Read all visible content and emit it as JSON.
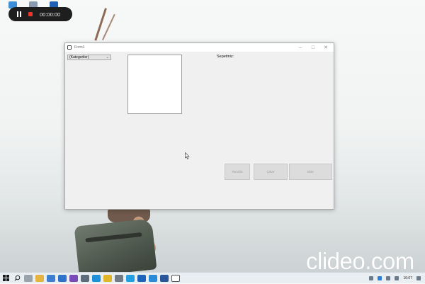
{
  "recorder": {
    "time": "00:00:00"
  },
  "window": {
    "title": "Form1",
    "combo_value": "(Kategoriler)",
    "cart_label": "Sepetiniz:",
    "buttons": [
      "Temizle",
      "Çıkar",
      "Ekle"
    ]
  },
  "watermark": "clideo.com",
  "taskbar": {
    "time": "16:07"
  },
  "colors": {
    "recorder_bg": "#1e1e1e",
    "stop_red": "#e8392c",
    "window_bg": "#f0f0f0",
    "button_bg": "#dcdcdc",
    "taskbar_bg": "#e9eef2"
  }
}
